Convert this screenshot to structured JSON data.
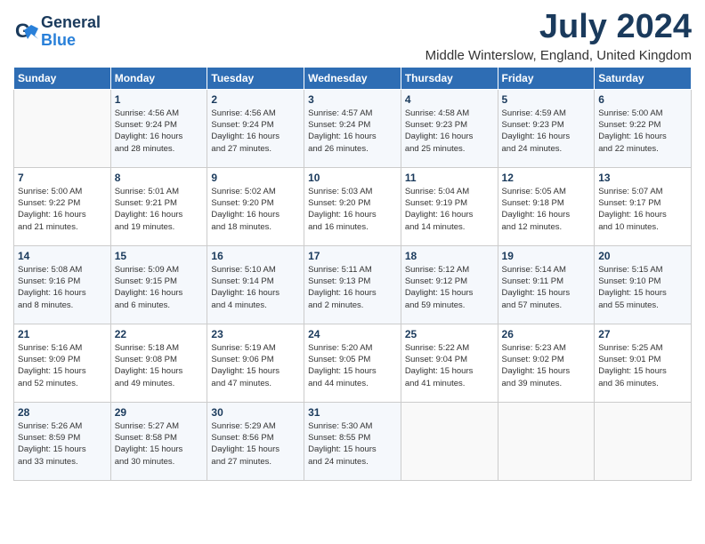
{
  "app": {
    "logo_line1": "General",
    "logo_line2": "Blue"
  },
  "header": {
    "month_title": "July 2024",
    "subtitle": "Middle Winterslow, England, United Kingdom"
  },
  "days_of_week": [
    "Sunday",
    "Monday",
    "Tuesday",
    "Wednesday",
    "Thursday",
    "Friday",
    "Saturday"
  ],
  "weeks": [
    [
      {
        "day": "",
        "info": ""
      },
      {
        "day": "1",
        "info": "Sunrise: 4:56 AM\nSunset: 9:24 PM\nDaylight: 16 hours\nand 28 minutes."
      },
      {
        "day": "2",
        "info": "Sunrise: 4:56 AM\nSunset: 9:24 PM\nDaylight: 16 hours\nand 27 minutes."
      },
      {
        "day": "3",
        "info": "Sunrise: 4:57 AM\nSunset: 9:24 PM\nDaylight: 16 hours\nand 26 minutes."
      },
      {
        "day": "4",
        "info": "Sunrise: 4:58 AM\nSunset: 9:23 PM\nDaylight: 16 hours\nand 25 minutes."
      },
      {
        "day": "5",
        "info": "Sunrise: 4:59 AM\nSunset: 9:23 PM\nDaylight: 16 hours\nand 24 minutes."
      },
      {
        "day": "6",
        "info": "Sunrise: 5:00 AM\nSunset: 9:22 PM\nDaylight: 16 hours\nand 22 minutes."
      }
    ],
    [
      {
        "day": "7",
        "info": "Sunrise: 5:00 AM\nSunset: 9:22 PM\nDaylight: 16 hours\nand 21 minutes."
      },
      {
        "day": "8",
        "info": "Sunrise: 5:01 AM\nSunset: 9:21 PM\nDaylight: 16 hours\nand 19 minutes."
      },
      {
        "day": "9",
        "info": "Sunrise: 5:02 AM\nSunset: 9:20 PM\nDaylight: 16 hours\nand 18 minutes."
      },
      {
        "day": "10",
        "info": "Sunrise: 5:03 AM\nSunset: 9:20 PM\nDaylight: 16 hours\nand 16 minutes."
      },
      {
        "day": "11",
        "info": "Sunrise: 5:04 AM\nSunset: 9:19 PM\nDaylight: 16 hours\nand 14 minutes."
      },
      {
        "day": "12",
        "info": "Sunrise: 5:05 AM\nSunset: 9:18 PM\nDaylight: 16 hours\nand 12 minutes."
      },
      {
        "day": "13",
        "info": "Sunrise: 5:07 AM\nSunset: 9:17 PM\nDaylight: 16 hours\nand 10 minutes."
      }
    ],
    [
      {
        "day": "14",
        "info": "Sunrise: 5:08 AM\nSunset: 9:16 PM\nDaylight: 16 hours\nand 8 minutes."
      },
      {
        "day": "15",
        "info": "Sunrise: 5:09 AM\nSunset: 9:15 PM\nDaylight: 16 hours\nand 6 minutes."
      },
      {
        "day": "16",
        "info": "Sunrise: 5:10 AM\nSunset: 9:14 PM\nDaylight: 16 hours\nand 4 minutes."
      },
      {
        "day": "17",
        "info": "Sunrise: 5:11 AM\nSunset: 9:13 PM\nDaylight: 16 hours\nand 2 minutes."
      },
      {
        "day": "18",
        "info": "Sunrise: 5:12 AM\nSunset: 9:12 PM\nDaylight: 15 hours\nand 59 minutes."
      },
      {
        "day": "19",
        "info": "Sunrise: 5:14 AM\nSunset: 9:11 PM\nDaylight: 15 hours\nand 57 minutes."
      },
      {
        "day": "20",
        "info": "Sunrise: 5:15 AM\nSunset: 9:10 PM\nDaylight: 15 hours\nand 55 minutes."
      }
    ],
    [
      {
        "day": "21",
        "info": "Sunrise: 5:16 AM\nSunset: 9:09 PM\nDaylight: 15 hours\nand 52 minutes."
      },
      {
        "day": "22",
        "info": "Sunrise: 5:18 AM\nSunset: 9:08 PM\nDaylight: 15 hours\nand 49 minutes."
      },
      {
        "day": "23",
        "info": "Sunrise: 5:19 AM\nSunset: 9:06 PM\nDaylight: 15 hours\nand 47 minutes."
      },
      {
        "day": "24",
        "info": "Sunrise: 5:20 AM\nSunset: 9:05 PM\nDaylight: 15 hours\nand 44 minutes."
      },
      {
        "day": "25",
        "info": "Sunrise: 5:22 AM\nSunset: 9:04 PM\nDaylight: 15 hours\nand 41 minutes."
      },
      {
        "day": "26",
        "info": "Sunrise: 5:23 AM\nSunset: 9:02 PM\nDaylight: 15 hours\nand 39 minutes."
      },
      {
        "day": "27",
        "info": "Sunrise: 5:25 AM\nSunset: 9:01 PM\nDaylight: 15 hours\nand 36 minutes."
      }
    ],
    [
      {
        "day": "28",
        "info": "Sunrise: 5:26 AM\nSunset: 8:59 PM\nDaylight: 15 hours\nand 33 minutes."
      },
      {
        "day": "29",
        "info": "Sunrise: 5:27 AM\nSunset: 8:58 PM\nDaylight: 15 hours\nand 30 minutes."
      },
      {
        "day": "30",
        "info": "Sunrise: 5:29 AM\nSunset: 8:56 PM\nDaylight: 15 hours\nand 27 minutes."
      },
      {
        "day": "31",
        "info": "Sunrise: 5:30 AM\nSunset: 8:55 PM\nDaylight: 15 hours\nand 24 minutes."
      },
      {
        "day": "",
        "info": ""
      },
      {
        "day": "",
        "info": ""
      },
      {
        "day": "",
        "info": ""
      }
    ]
  ]
}
